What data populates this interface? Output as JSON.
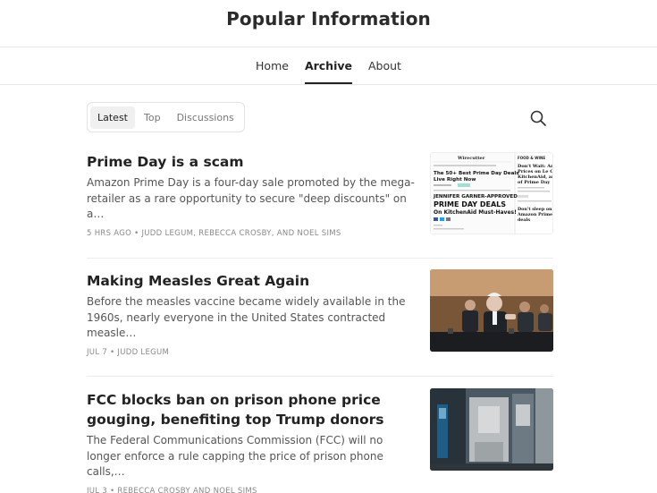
{
  "site": {
    "title": "Popular Information"
  },
  "nav": [
    {
      "label": "Home",
      "active": false
    },
    {
      "label": "Archive",
      "active": true
    },
    {
      "label": "About",
      "active": false
    }
  ],
  "filters": [
    {
      "label": "Latest",
      "active": true
    },
    {
      "label": "Top",
      "active": false
    },
    {
      "label": "Discussions",
      "active": false
    }
  ],
  "search": {
    "icon": "search-icon"
  },
  "posts": [
    {
      "title": "Prime Day is a scam",
      "subtitle": "Amazon Prime Day is a four-day sale promoted by the mega-retailer as a rare opportunity to secure \"deep discounts\" on a…",
      "meta": "5 HRS AGO • JUDD LEGUM, REBECCA CROSBY, AND NOEL SIMS",
      "thumb": {
        "left_header": "Wirecutter",
        "left_headline": "The 50+ Best Prime Day Deals Live Right Now",
        "left_big": "JENNIFER GARNER-APPROVED",
        "left_big2": "PRIME DAY DEALS",
        "left_big3": "On KitchenAid Must-Haves!",
        "right_header": "FOOD & WINE",
        "right_text": "Don't Wait: Amazon Prices on Le Creuset, KitchenAid, and of Prime Day",
        "right_text2": "Don't sleep on the Amazon Prime Day deals"
      }
    },
    {
      "title": "Making Measles Great Again",
      "subtitle": "Before the measles vaccine became widely available in the 1960s, nearly everyone in the United States contracted measle…",
      "meta": "JUL 7 • JUDD LEGUM"
    },
    {
      "title": "FCC blocks ban on prison phone price gouging, benefiting top Trump donors",
      "subtitle": "The Federal Communications Commission (FCC) will no longer enforce a rule capping the price of prison phone calls,…",
      "meta": "JUL 3 • REBECCA CROSBY AND NOEL SIMS"
    }
  ]
}
